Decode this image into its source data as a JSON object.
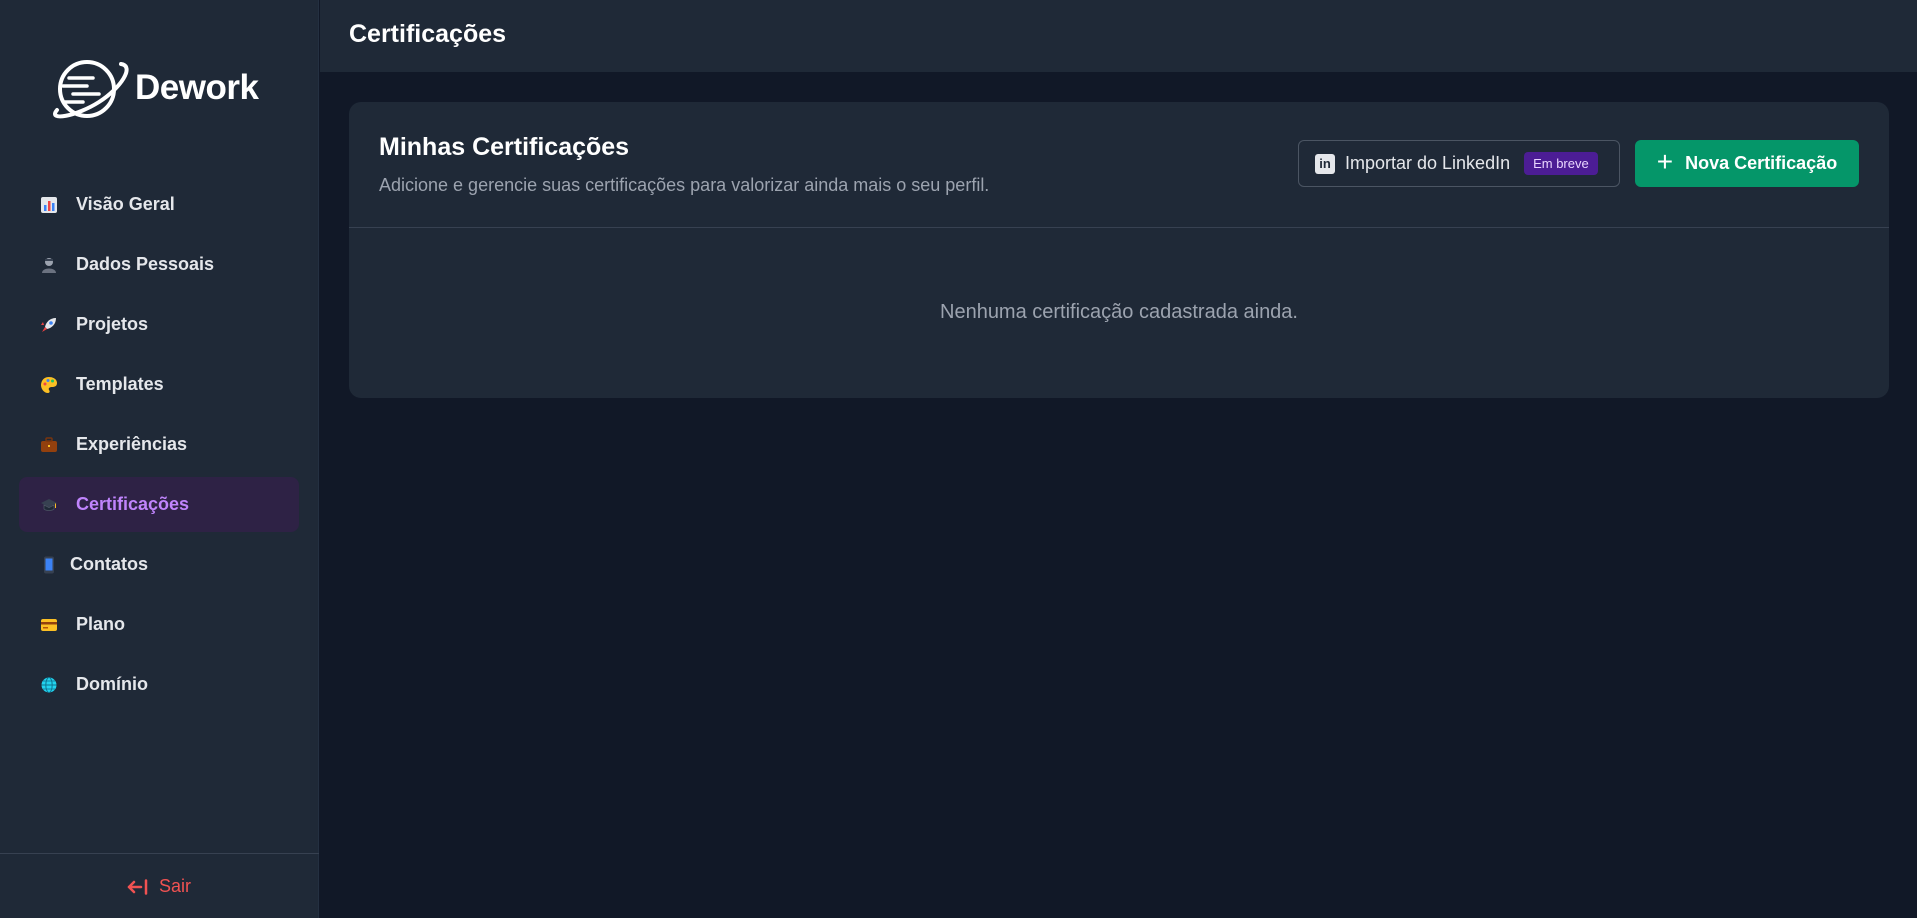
{
  "brand": {
    "name": "Dework"
  },
  "header": {
    "title": "Certificações"
  },
  "sidebar": {
    "items": [
      {
        "label": "Visão Geral",
        "icon": "bar-chart-icon",
        "active": false
      },
      {
        "label": "Dados Pessoais",
        "icon": "person-icon",
        "active": false
      },
      {
        "label": "Projetos",
        "icon": "rocket-icon",
        "active": false
      },
      {
        "label": "Templates",
        "icon": "palette-icon",
        "active": false
      },
      {
        "label": "Experiências",
        "icon": "briefcase-icon",
        "active": false
      },
      {
        "label": "Certificações",
        "icon": "graduation-cap-icon",
        "active": true
      },
      {
        "label": "Contatos",
        "icon": "mobile-phone-icon",
        "active": false
      },
      {
        "label": "Plano",
        "icon": "credit-card-icon",
        "active": false
      },
      {
        "label": "Domínio",
        "icon": "globe-icon",
        "active": false
      }
    ],
    "logout_label": "Sair"
  },
  "main": {
    "card_title": "Minhas Certificações",
    "card_subtitle": "Adicione e gerencie suas certificações para valorizar ainda mais o seu perfil.",
    "linkedin_button": {
      "label": "Importar do LinkedIn",
      "badge": "Em breve",
      "icon": "linkedin-icon"
    },
    "new_button": {
      "label": "Nova Certificação",
      "icon": "plus-icon"
    },
    "empty_message": "Nenhuma certificação cadastrada ainda."
  },
  "colors": {
    "background": "#111827",
    "surface": "#1f2937",
    "accent_purple": "#c084fc",
    "active_bg": "#2e2245",
    "primary_green": "#059669",
    "danger": "#f05252"
  }
}
